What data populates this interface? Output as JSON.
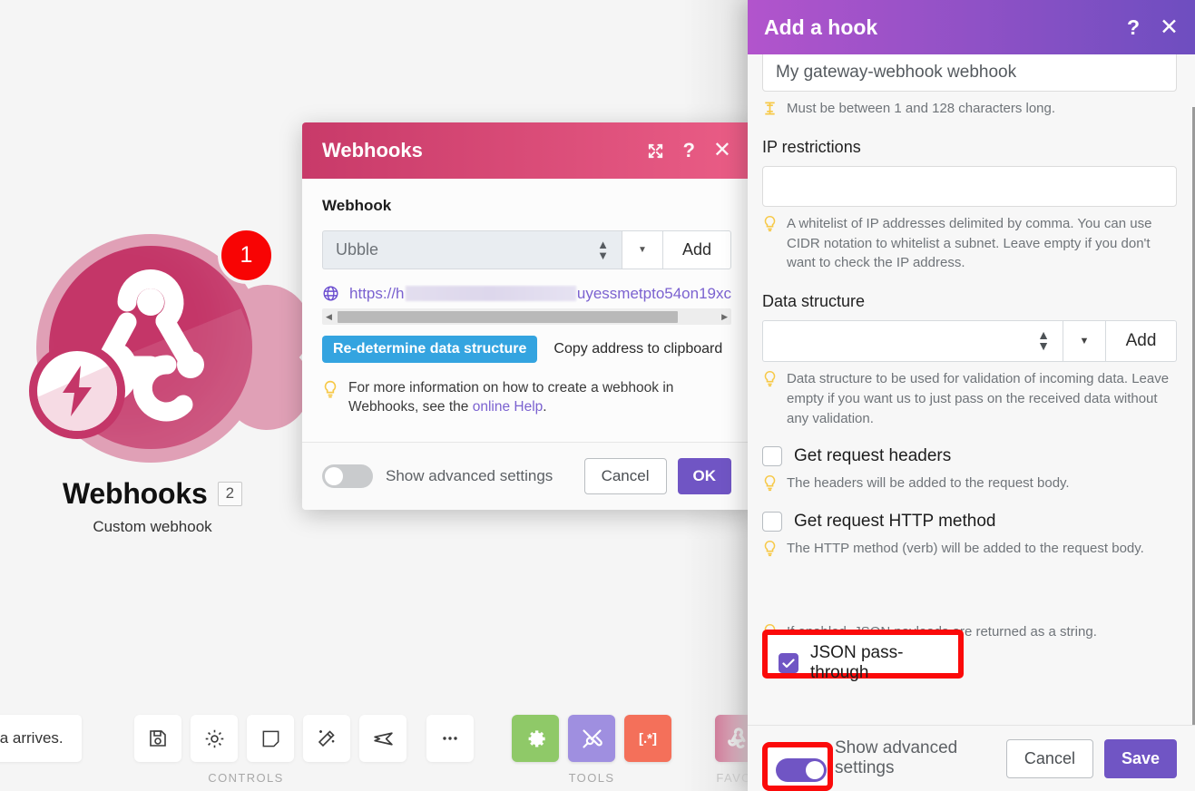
{
  "canvas": {
    "node": {
      "title": "Webhooks",
      "module_number": "2",
      "badge_count": "1",
      "subtitle": "Custom webhook",
      "icon": "webhook-icon",
      "colors": {
        "disc": "#c43668",
        "halo": "#e0a0b6",
        "badge": "#f80404"
      }
    },
    "toolbar": {
      "tooltip_fragment": "ta arrives.",
      "groups": [
        {
          "label": "CONTROLS",
          "items": [
            {
              "icon": "save-icon",
              "color": "#ffffff"
            },
            {
              "icon": "gear-icon",
              "color": "#ffffff"
            },
            {
              "icon": "note-icon",
              "color": "#ffffff"
            },
            {
              "icon": "magic-wand-icon",
              "color": "#ffffff"
            },
            {
              "icon": "airplane-icon",
              "color": "#ffffff"
            },
            {
              "icon": "more-ellipsis-icon",
              "color": "#ffffff"
            }
          ]
        },
        {
          "label": "TOOLS",
          "items": [
            {
              "icon": "gear-tool-icon",
              "color": "#8fc968"
            },
            {
              "icon": "tools-wrench-icon",
              "color": "#9f8fe0"
            },
            {
              "icon": "regex-icon",
              "color": "#f4705a"
            }
          ]
        },
        {
          "label": "FAVO",
          "items": [
            {
              "icon": "webhook-icon",
              "color": "#c43668"
            }
          ]
        }
      ]
    }
  },
  "webhooks_modal": {
    "title": "Webhooks",
    "header_icons": [
      "expand-icon",
      "help-icon",
      "close-icon"
    ],
    "section_label": "Webhook",
    "select_value": "Ubble",
    "add_label": "Add",
    "url_prefix": "https://h",
    "url_suffix": "uyessmetpto54on19xc",
    "url_redacted": true,
    "redetermine_label": "Re-determine data structure",
    "copy_label": "Copy address to clipboard",
    "hint": {
      "text_before": "For more information on how to create a webhook in Webhooks, see the ",
      "link": "online Help",
      "text_after": "."
    },
    "footer": {
      "toggle_label": "Show advanced settings",
      "toggle_on": false,
      "cancel_label": "Cancel",
      "confirm_label": "OK"
    }
  },
  "hook_panel": {
    "title": "Add a hook",
    "header_icons": [
      "help-icon",
      "close-icon"
    ],
    "name_value": "My gateway-webhook webhook",
    "name_hint": "Must be between 1 and 128 characters long.",
    "ip": {
      "label": "IP restrictions",
      "value": "",
      "hint": "A whitelist of IP addresses delimited by comma. You can use CIDR notation to whitelist a subnet. Leave empty if you don't want to check the IP address."
    },
    "data_structure": {
      "label": "Data structure",
      "value": "",
      "add_label": "Add",
      "hint": "Data structure to be used for validation of incoming data. Leave empty if you want us to just pass on the received data without any validation."
    },
    "checkboxes": [
      {
        "label": "Get request headers",
        "checked": false,
        "hint": "The headers will be added to the request body."
      },
      {
        "label": "Get request HTTP method",
        "checked": false,
        "hint": "The HTTP method (verb) will be added to the request body."
      }
    ],
    "json_passthrough": {
      "label": "JSON pass-through",
      "checked": true,
      "hint": "If enabled, JSON payloads are returned as a string.",
      "highlighted": true
    },
    "footer": {
      "toggle_label": "Show advanced settings",
      "toggle_on": true,
      "toggle_highlighted": true,
      "cancel_label": "Cancel",
      "save_label": "Save"
    },
    "colors": {
      "header_gradient_start": "#b254cc",
      "header_gradient_end": "#6e4ec0",
      "accent": "#7055c4",
      "highlight": "#fb0a0a"
    }
  }
}
